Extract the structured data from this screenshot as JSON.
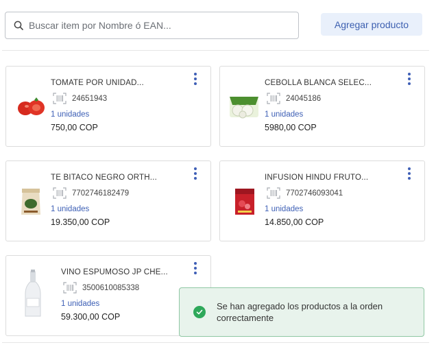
{
  "search": {
    "placeholder": "Buscar item por Nombre ó EAN...",
    "icon": "search-icon"
  },
  "toolbar": {
    "add_label": "Agregar producto",
    "accent": "#3c5fb0"
  },
  "products": [
    {
      "name": "TOMATE POR UNIDAD...",
      "ean": "24651943",
      "units": "1 unidades",
      "price": "750,00 COP",
      "image": "tomato"
    },
    {
      "name": "CEBOLLA BLANCA SELEC...",
      "ean": "24045186",
      "units": "1 unidades",
      "price": "5980,00 COP",
      "image": "onion-pack"
    },
    {
      "name": "TE BITACO NEGRO ORTH...",
      "ean": "7702746182479",
      "units": "1 unidades",
      "price": "19.350,00 COP",
      "image": "tea-bag"
    },
    {
      "name": "INFUSION HINDU FRUTO...",
      "ean": "7702746093041",
      "units": "1 unidades",
      "price": "14.850,00 COP",
      "image": "infusion-box"
    },
    {
      "name": "VINO ESPUMOSO JP CHE...",
      "ean": "3500610085338",
      "units": "1 unidades",
      "price": "59.300,00 COP",
      "image": "wine-bottle"
    }
  ],
  "toast": {
    "message": "Se han agregado los productos a la orden correctamente",
    "status_color": "#2ea85a"
  }
}
